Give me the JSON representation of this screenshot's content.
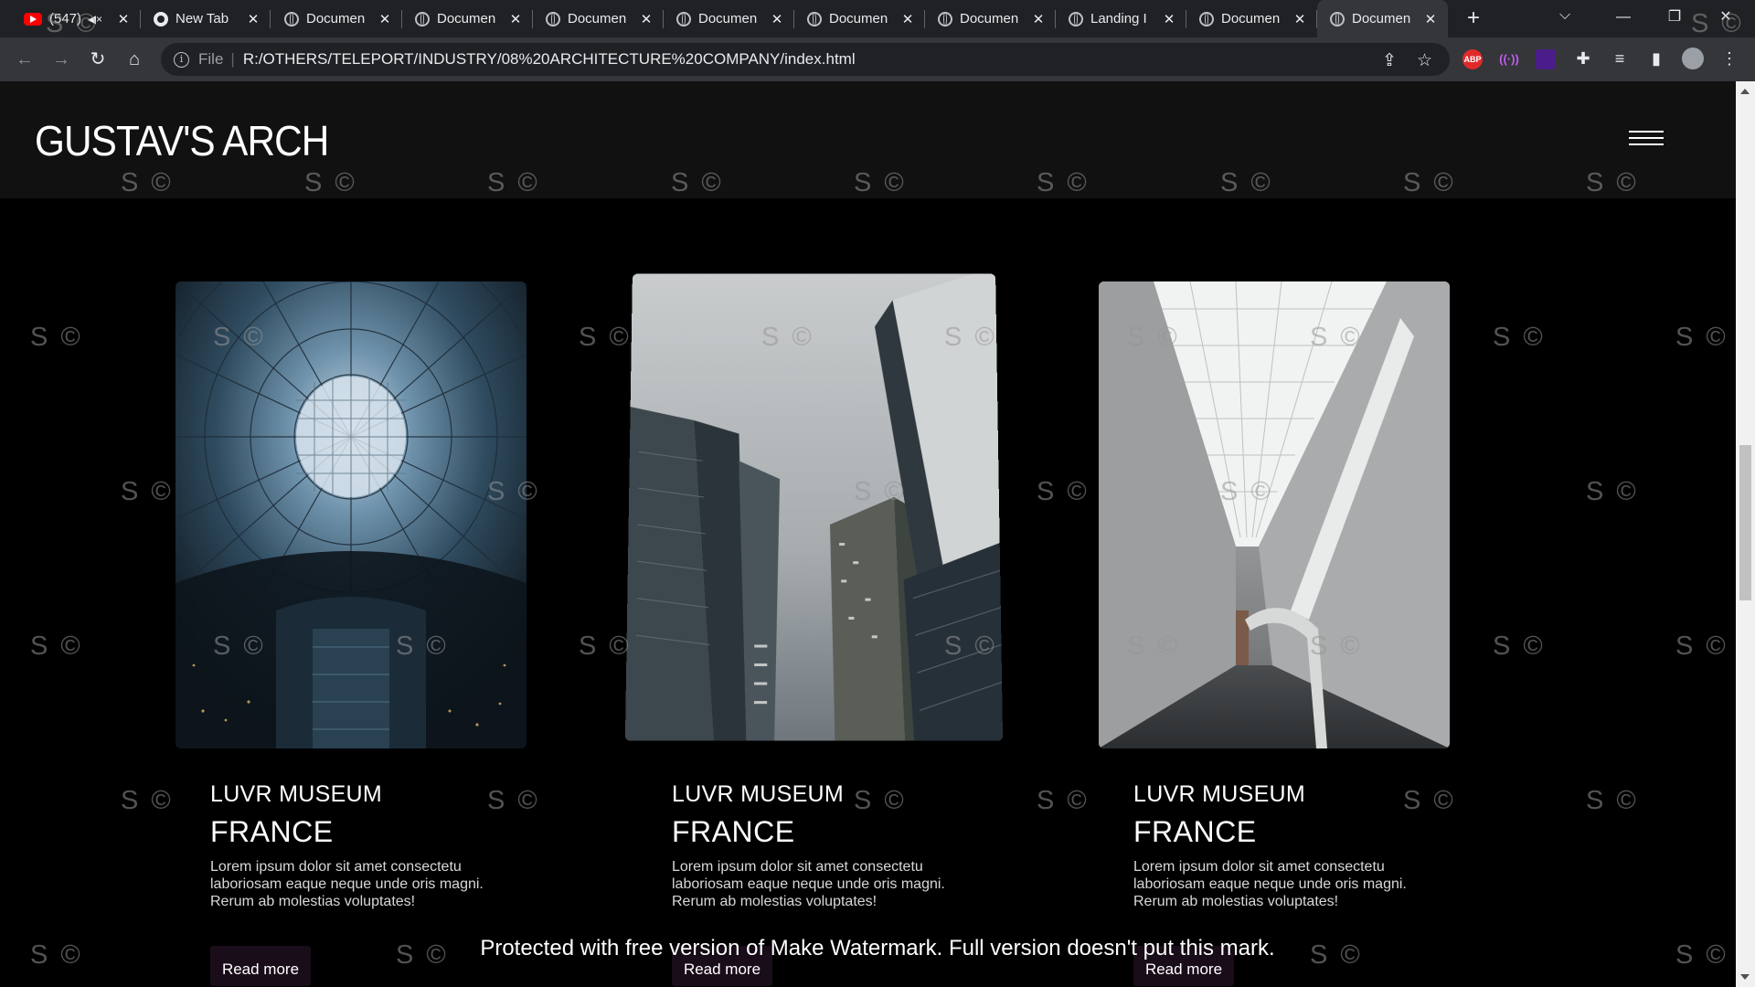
{
  "browser": {
    "tabs": [
      {
        "title": "(547)",
        "icon": "youtube-icon",
        "muted": true
      },
      {
        "title": "New Tab",
        "icon": "chrome-icon"
      },
      {
        "title": "Documen",
        "icon": "globe-icon"
      },
      {
        "title": "Documen",
        "icon": "globe-icon"
      },
      {
        "title": "Documen",
        "icon": "globe-icon"
      },
      {
        "title": "Documen",
        "icon": "globe-icon"
      },
      {
        "title": "Documen",
        "icon": "globe-icon"
      },
      {
        "title": "Documen",
        "icon": "globe-icon"
      },
      {
        "title": "Landing I",
        "icon": "globe-icon"
      },
      {
        "title": "Documen",
        "icon": "globe-icon"
      },
      {
        "title": "Documen",
        "icon": "globe-icon",
        "active": true
      }
    ],
    "scheme": "File",
    "url": "R:/OTHERS/TELEPORT/INDUSTRY/08%20ARCHITECTURE%20COMPANY/index.html",
    "extensions": {
      "abp": "ABP"
    },
    "colors": {
      "tabstrip": "#202124",
      "toolbar": "#35363a",
      "omnibox": "#202124"
    }
  },
  "site": {
    "logo": "GUSTAV'S ARCH",
    "cards": [
      {
        "title": "LUVR MUSEUM",
        "country": "FRANCE",
        "desc": "Lorem ipsum dolor sit amet consectetu laboriosam eaque neque unde oris magni. Rerum ab molestias voluptates!",
        "button": "Read more",
        "photo": "glass-dome-atrium"
      },
      {
        "title": "LUVR MUSEUM",
        "country": "FRANCE",
        "desc": "Lorem ipsum dolor sit amet consectetu laboriosam eaque neque unde oris magni. Rerum ab molestias voluptates!",
        "button": "Read more",
        "photo": "foggy-skyscrapers"
      },
      {
        "title": "LUVR MUSEUM",
        "country": "FRANCE",
        "desc": "Lorem ipsum dolor sit amet consectetu laboriosam eaque neque unde oris magni. Rerum ab molestias voluptates!",
        "button": "Read more",
        "photo": "white-corridor"
      }
    ],
    "colors": {
      "background": "#000000",
      "header": "#111112",
      "button": "#1a0d1a"
    }
  },
  "watermark": {
    "mark": "S ©",
    "banner": "Protected with free version of Make Watermark. Full version doesn't put this mark."
  }
}
